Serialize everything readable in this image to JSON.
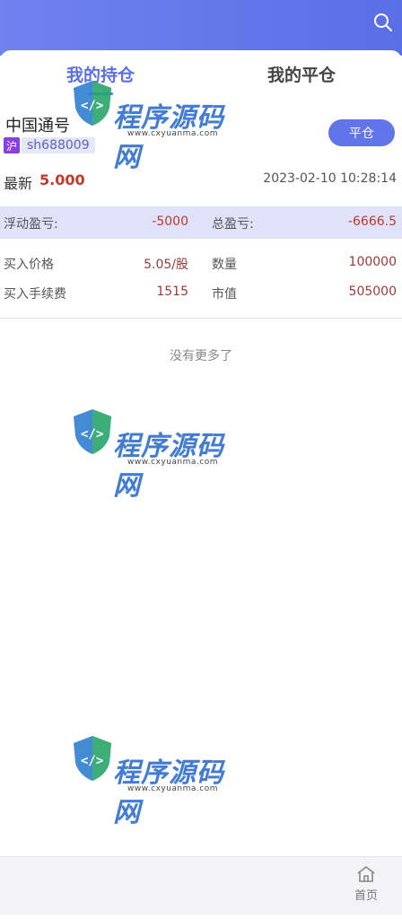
{
  "header": {
    "search_icon": "search-icon"
  },
  "tabs": [
    {
      "label": "我的持仓",
      "active": true
    },
    {
      "label": "我的平仓",
      "active": false
    }
  ],
  "position": {
    "name": "中国通号",
    "market_badge": "沪",
    "code": "sh688009",
    "close_button": "平仓",
    "latest_label": "最新",
    "latest_price": "5.000",
    "datetime": "2023-02-10 10:28:14",
    "floating_pl_label": "浮动盈亏:",
    "floating_pl_value": "-5000",
    "total_pl_label": "总盈亏:",
    "total_pl_value": "-6666.5",
    "buy_price_label": "买入价格",
    "buy_price_value": "5.05/股",
    "quantity_label": "数量",
    "quantity_value": "100000",
    "buy_fee_label": "买入手续费",
    "buy_fee_value": "1515",
    "market_value_label": "市值",
    "market_value_value": "505000"
  },
  "list_end_text": "没有更多了",
  "watermark": {
    "text": "程序源码网",
    "url": "www.cxyuanma.com"
  },
  "bottom_nav": {
    "home_label": "首页",
    "home_icon": "home-icon"
  },
  "colors": {
    "accent": "#5a6fe6",
    "loss": "#c0392b",
    "band": "#dfe2f9"
  }
}
